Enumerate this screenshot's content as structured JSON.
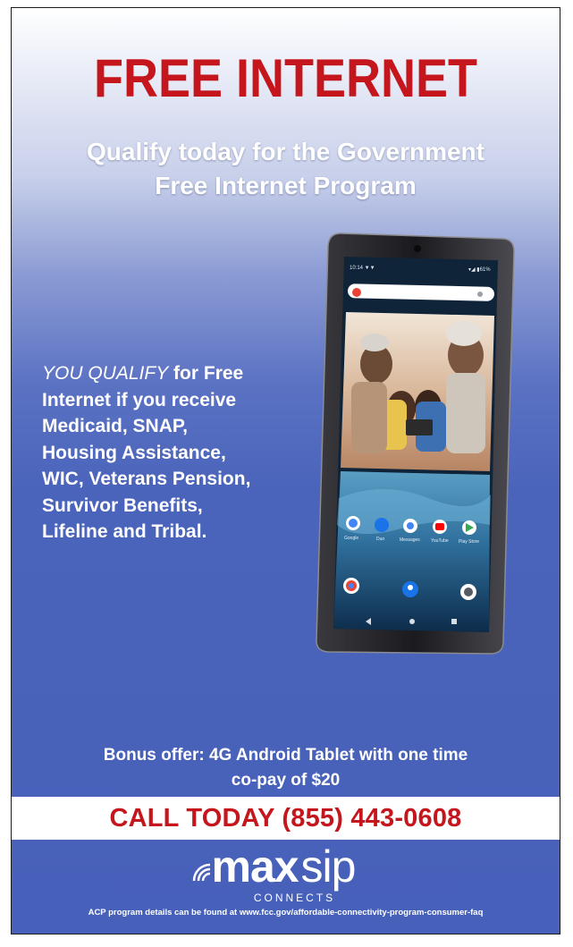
{
  "headline": "FREE INTERNET",
  "subhead": {
    "line1": "Qualify today for the Government",
    "line2": "Free Internet Program"
  },
  "qualify": {
    "lead": "YOU QUALIFY",
    "lines": [
      " for Free",
      "Internet if you receive",
      "Medicaid, SNAP,",
      "Housing Assistance,",
      "WIC, Veterans Pension,",
      "Survivor Benefits,",
      "Lifeline and Tribal."
    ]
  },
  "bonus": {
    "line1": "Bonus offer: 4G Android Tablet with one time",
    "line2": "co-pay of $20"
  },
  "cta": "CALL TODAY (855) 443-0608",
  "logo": {
    "bold": "max",
    "light": "sip",
    "tagline": "CONNECTS"
  },
  "fineprint": "ACP program details can be found at www.fcc.gov/affordable-connectivity-program-consumer-faq",
  "tablet": {
    "status_time": "10:14",
    "app_labels": [
      "Google",
      "Duo",
      "Messages",
      "YouTube",
      "Play Store"
    ],
    "icons": [
      "wifi-icon",
      "chrome-icon",
      "contacts-icon",
      "camera-icon",
      "google-icon",
      "youtube-icon",
      "play-store-icon"
    ]
  },
  "colors": {
    "headline_red": "#c4161c",
    "background_blue": "#4760b9",
    "text_white": "#ffffff"
  }
}
